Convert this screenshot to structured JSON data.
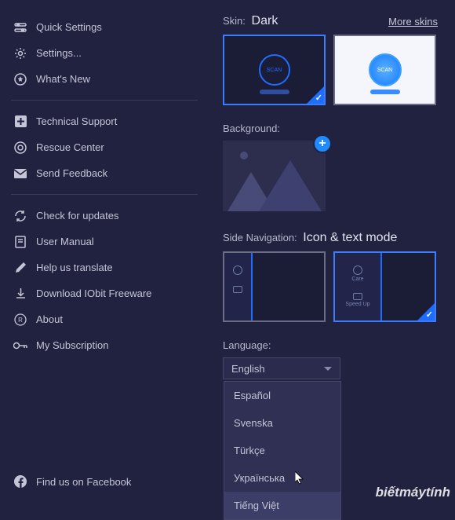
{
  "sidebar": {
    "group1": [
      {
        "label": "Quick Settings"
      },
      {
        "label": "Settings..."
      },
      {
        "label": "What's New"
      }
    ],
    "group2": [
      {
        "label": "Technical Support"
      },
      {
        "label": "Rescue Center"
      },
      {
        "label": "Send Feedback"
      }
    ],
    "group3": [
      {
        "label": "Check for updates"
      },
      {
        "label": "User Manual"
      },
      {
        "label": "Help us translate"
      },
      {
        "label": "Download IObit Freeware"
      },
      {
        "label": "About"
      },
      {
        "label": "My Subscription"
      }
    ],
    "facebook": "Find us on Facebook"
  },
  "skin": {
    "label": "Skin:",
    "value": "Dark",
    "more": "More skins",
    "scan": "SCAN"
  },
  "background": {
    "label": "Background:"
  },
  "sidenav": {
    "label": "Side Navigation:",
    "value": "Icon & text mode",
    "care": "Care",
    "speedup": "Speed Up"
  },
  "language": {
    "label": "Language:",
    "selected": "English",
    "options": [
      "Español",
      "Svenska",
      "Türkçe",
      "Українська",
      "Tiếng Việt"
    ]
  },
  "watermark": "biếtmáytính"
}
